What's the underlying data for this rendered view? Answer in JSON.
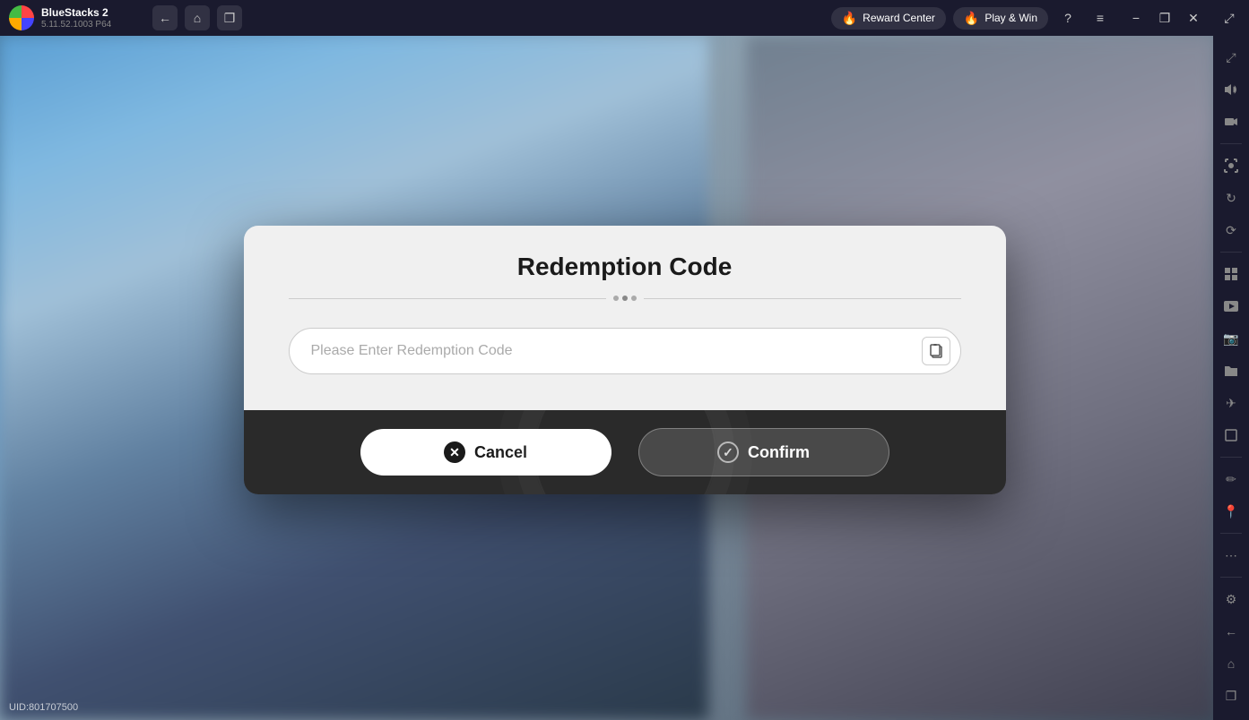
{
  "app": {
    "name": "BlueStacks 2",
    "version": "5.11.52.1003  P64"
  },
  "topbar": {
    "back_label": "←",
    "home_label": "⌂",
    "pages_label": "❐",
    "reward_center_label": "Reward Center",
    "reward_center_emoji": "🔥",
    "play_win_label": "Play & Win",
    "play_win_emoji": "🔥",
    "help_label": "?",
    "menu_label": "≡",
    "minimize_label": "−",
    "restore_label": "❐",
    "close_label": "✕",
    "expand_label": "⤢"
  },
  "sidebar": {
    "icons": [
      {
        "name": "fullscreen-icon",
        "symbol": "⤢"
      },
      {
        "name": "volume-icon",
        "symbol": "🔊"
      },
      {
        "name": "video-icon",
        "symbol": "▶"
      },
      {
        "name": "screenshot-icon",
        "symbol": "📷"
      },
      {
        "name": "sync-icon",
        "symbol": "↻"
      },
      {
        "name": "rotation-icon",
        "symbol": "⟳"
      },
      {
        "name": "apps-icon",
        "symbol": "⊞"
      },
      {
        "name": "media-icon",
        "symbol": "🎬"
      },
      {
        "name": "screenshot2-icon",
        "symbol": "📸"
      },
      {
        "name": "folder-icon",
        "symbol": "📁"
      },
      {
        "name": "flight-icon",
        "symbol": "✈"
      },
      {
        "name": "resize-icon",
        "symbol": "⊡"
      },
      {
        "name": "brush-icon",
        "symbol": "✏"
      },
      {
        "name": "map-icon",
        "symbol": "📍"
      },
      {
        "name": "more-icon",
        "symbol": "⋯"
      },
      {
        "name": "settings-icon",
        "symbol": "⚙"
      },
      {
        "name": "back-icon",
        "symbol": "←"
      },
      {
        "name": "home2-icon",
        "symbol": "⌂"
      },
      {
        "name": "pages2-icon",
        "symbol": "❐"
      }
    ]
  },
  "dialog": {
    "title": "Redemption Code",
    "input_placeholder": "Please Enter Redemption Code",
    "cancel_label": "Cancel",
    "confirm_label": "Confirm"
  },
  "uid": {
    "label": "UID:801707500"
  }
}
